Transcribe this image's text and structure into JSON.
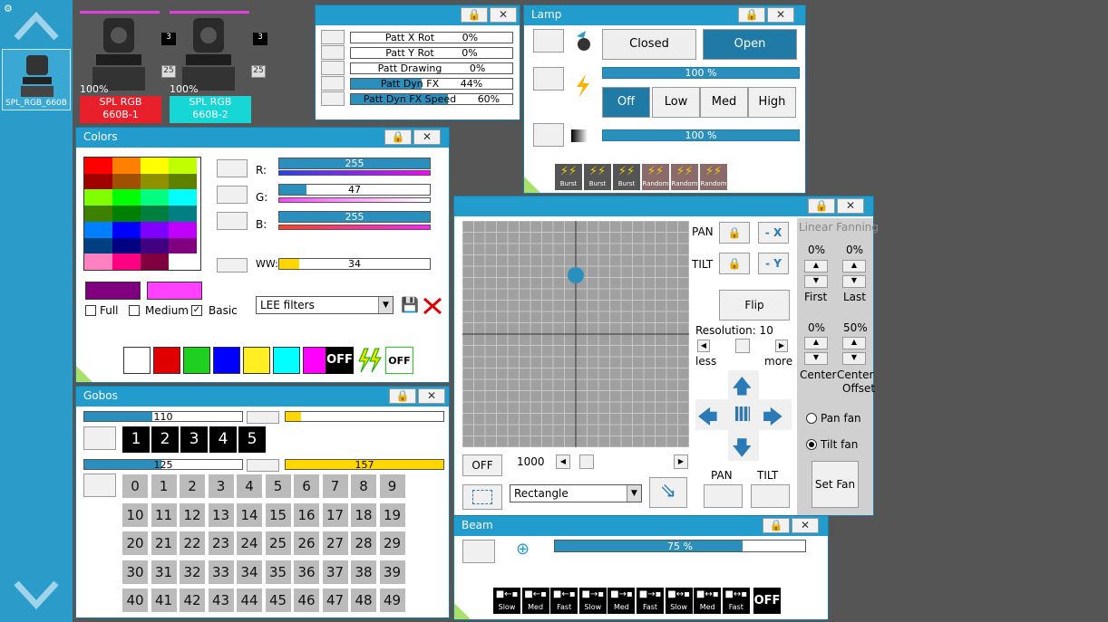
{
  "fixtures": [
    {
      "name": "SPL_RGB_660B",
      "number": "3",
      "value": "25",
      "percent": "100%",
      "label_line1": "SPL RGB",
      "label_line2": "660B-1",
      "label_color": "#e8202c"
    },
    {
      "name": "SPL_RGB_660B",
      "number": "3",
      "value": "25",
      "percent": "100%",
      "label_line1": "SPL RGB",
      "label_line2": "660B-2",
      "label_color": "#16d6d6"
    }
  ],
  "sidebar": {
    "selected_fixture": "SPL_RGB_660B"
  },
  "pattern_window": {
    "rows": [
      {
        "label": "Patt X Rot",
        "value": "0%",
        "level": 0
      },
      {
        "label": "Patt Y Rot",
        "value": "0%",
        "level": 0
      },
      {
        "label": "Patt Drawing",
        "value": "0%",
        "level": 0
      },
      {
        "label": "Patt Dyn FX",
        "value": "44%",
        "level": 0.44
      },
      {
        "label": "Patt Dyn FX Speed",
        "value": "60%",
        "level": 0.6
      }
    ]
  },
  "lamp": {
    "title": "Lamp",
    "closed_label": "Closed",
    "open_label": "Open",
    "bar1": "100 %",
    "bar1_level": 1.0,
    "off_label": "Off",
    "low_label": "Low",
    "med_label": "Med",
    "high_label": "High",
    "bar2": "100 %",
    "bar2_level": 1.0,
    "effects": [
      "Burst",
      "Burst",
      "Burst",
      "Random",
      "Random",
      "Random"
    ]
  },
  "colors": {
    "title": "Colors",
    "r_label": "R:",
    "r_value": "255",
    "r_level": 1.0,
    "g_label": "G:",
    "g_value": "47",
    "g_level": 0.18,
    "b_label": "B:",
    "b_value": "255",
    "b_level": 1.0,
    "ww_label": "WW:",
    "ww_value": "34",
    "ww_level": 0.13,
    "full_label": "Full",
    "medium_label": "Medium",
    "basic_label": "Basic",
    "filter_select": "LEE filters",
    "off_label": "OFF",
    "palette": [
      "#ff0000",
      "#ff8000",
      "#ffff00",
      "#c0ff00",
      "#a00000",
      "#a05000",
      "#909000",
      "#608000",
      "#80ff00",
      "#00ff00",
      "#00ff80",
      "#00ffff",
      "#408000",
      "#008000",
      "#008040",
      "#008080",
      "#0080ff",
      "#0000ff",
      "#8000ff",
      "#c000ff",
      "#004080",
      "#000080",
      "#400080",
      "#800080",
      "#ff80c0",
      "#ff0080",
      "#800040",
      "#ffffff"
    ],
    "quick": [
      "#ffffff",
      "#e00000",
      "#20d020",
      "#0000ff",
      "#ffee22",
      "#00ffff",
      "#ff00ff"
    ],
    "preview1": "#800080",
    "preview2": "#ff40ff"
  },
  "gobos": {
    "title": "Gobos",
    "bar1": "110",
    "bar1_level": 0.43,
    "bar2_level": 0.1,
    "bar3": "125",
    "bar3_level": 0.49,
    "bar4": "157",
    "bar4_level": 1.0,
    "wheel1": [
      "1",
      "2",
      "3",
      "4",
      "5"
    ],
    "wheel2": [
      "0",
      "1",
      "2",
      "3",
      "4",
      "5",
      "6",
      "7",
      "8",
      "9",
      "10",
      "11",
      "12",
      "13",
      "14",
      "15",
      "16",
      "17",
      "18",
      "19",
      "20",
      "21",
      "22",
      "23",
      "24",
      "25",
      "26",
      "27",
      "28",
      "29",
      "30",
      "31",
      "32",
      "33",
      "34",
      "35",
      "36",
      "37",
      "38",
      "39",
      "40",
      "41",
      "42",
      "43",
      "44",
      "45",
      "46",
      "47",
      "48",
      "49"
    ]
  },
  "position": {
    "pan_label": "PAN",
    "tilt_label": "TILT",
    "minus_x": "- X",
    "minus_y": "- Y",
    "flip_label": "Flip",
    "resolution_label": "Resolution: 10",
    "less_label": "less",
    "more_label": "more",
    "off_label": "OFF",
    "speed_value": "1000",
    "shape_select": "Rectangle",
    "pan_bottom": "PAN",
    "tilt_bottom": "TILT",
    "dot_x": 0.5,
    "dot_y": 0.24
  },
  "fanning": {
    "title": "Linear Fanning",
    "first_val": "0%",
    "last_val": "0%",
    "first_label": "First",
    "last_label": "Last",
    "center_val": "0%",
    "offset_val": "50%",
    "center_label": "Center",
    "offset_label1": "Center",
    "offset_label2": "Offset",
    "pan_fan": "Pan fan",
    "tilt_fan": "Tilt fan",
    "set_fan": "Set Fan"
  },
  "beam": {
    "title": "Beam",
    "bar": "75 %",
    "bar_level": 0.75,
    "buttons": [
      {
        "top": "■←▪",
        "bottom": "Slow"
      },
      {
        "top": "■←▪",
        "bottom": "Med"
      },
      {
        "top": "■←▪",
        "bottom": "Fast"
      },
      {
        "top": "■→▪",
        "bottom": "Slow"
      },
      {
        "top": "■→▪",
        "bottom": "Med"
      },
      {
        "top": "■→▪",
        "bottom": "Fast"
      },
      {
        "top": "■↔▪",
        "bottom": "Slow"
      },
      {
        "top": "■↔▪",
        "bottom": "Med"
      },
      {
        "top": "■↔▪",
        "bottom": "Fast"
      }
    ],
    "off_label": "OFF"
  }
}
